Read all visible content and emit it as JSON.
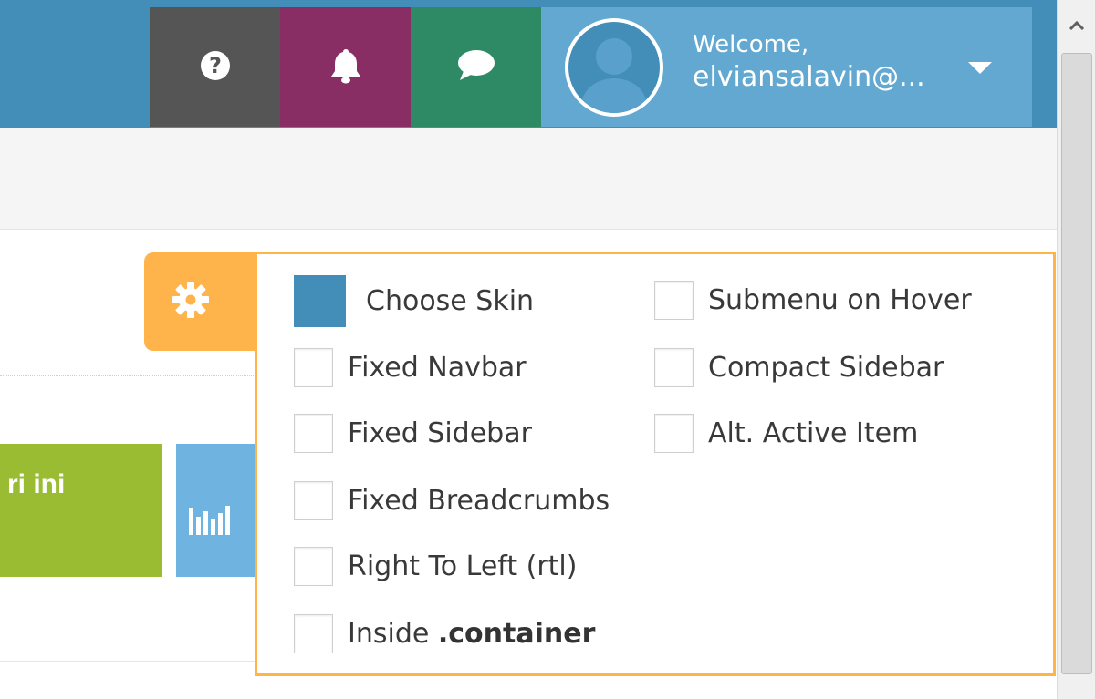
{
  "navbar": {
    "welcome_line1": "Welcome,",
    "welcome_line2": "elviansalavin@...",
    "colors": {
      "navbar": "#438eb9",
      "help": "#555555",
      "notifications": "#892e65",
      "messages": "#2e8965",
      "user": "#62a8d1"
    }
  },
  "tiles": {
    "green_text": "ri ini"
  },
  "settings": {
    "accent": "#ffb44b",
    "left_column": {
      "choose_skin": "Choose Skin",
      "fixed_navbar": "Fixed Navbar",
      "fixed_sidebar": "Fixed Sidebar",
      "fixed_breadcrumbs": "Fixed Breadcrumbs",
      "rtl": "Right To Left (rtl)",
      "inside_prefix": "Inside",
      "inside_bold": ".container"
    },
    "right_column": {
      "submenu_hover": "Submenu on Hover",
      "compact_sidebar": "Compact Sidebar",
      "alt_active_item": "Alt. Active Item"
    },
    "skin_color": "#438eb9"
  },
  "icons": {
    "help": "question-circle-icon",
    "notifications": "bell-icon",
    "messages": "comment-icon",
    "user": "user-avatar-icon",
    "dropdown": "caret-down-icon",
    "settings": "gear-icon",
    "chart": "bar-chart-icon"
  }
}
